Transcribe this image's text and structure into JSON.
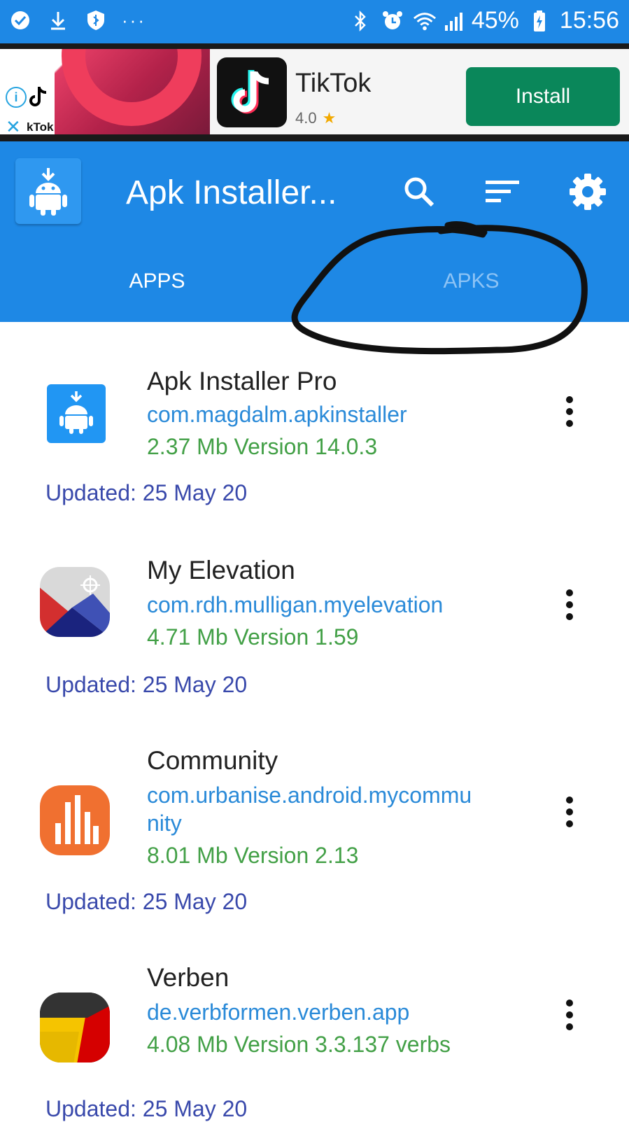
{
  "status_bar": {
    "left_icons": [
      "check-circle-icon",
      "download-icon",
      "shield-icon"
    ],
    "more": "···",
    "battery_percent": "45%",
    "time": "15:56"
  },
  "ad": {
    "brand_fragment": "kTok",
    "app_name": "TikTok",
    "rating": "4.0",
    "install_label": "Install"
  },
  "appbar": {
    "title": "Apk Installer..."
  },
  "tabs": [
    {
      "label": "APPS",
      "active": true
    },
    {
      "label": "APKS",
      "active": false
    }
  ],
  "apps": [
    {
      "name": "Apk Installer Pro",
      "package": "com.magdalm.apkinstaller",
      "size_version": "2.37 Mb Version 14.0.3",
      "updated": "Updated: 25 May 20",
      "icon": "android-install-icon"
    },
    {
      "name": "My Elevation",
      "package": "com.rdh.mulligan.myelevation",
      "size_version": "4.71 Mb Version 1.59",
      "updated": "Updated: 25 May 20",
      "icon": "elevation-icon"
    },
    {
      "name": "Community",
      "package": "com.urbanise.android.mycommunity",
      "size_version": "8.01 Mb Version 2.13",
      "updated": "Updated: 25 May 20",
      "icon": "community-icon"
    },
    {
      "name": "Verben",
      "package": "de.verbformen.verben.app",
      "size_version": "4.08 Mb Version 3.3.137 verbs",
      "updated": "Updated: 25 May 20",
      "icon": "verben-icon"
    }
  ],
  "colors": {
    "primary": "#1e88e5",
    "package_text": "#2a8ad8",
    "size_text": "#43a047",
    "updated_text": "#3949ab",
    "install_button": "#0a875a"
  }
}
